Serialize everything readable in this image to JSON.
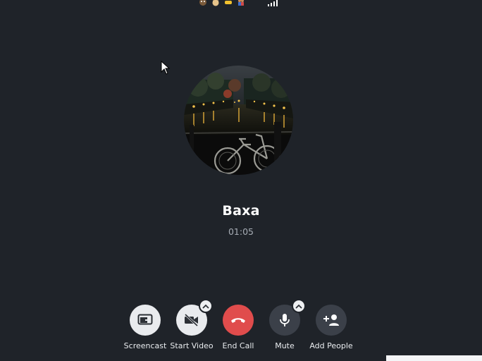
{
  "top_bar": {
    "icons": [
      "monkey-emoji-icon",
      "cat-emoji-icon",
      "pointing-hand-emoji-icon",
      "people-emoji-icon"
    ],
    "signal_icon": "signal-strength-icon"
  },
  "call": {
    "caller_name": "Baxa",
    "duration": "01:05"
  },
  "controls": {
    "screencast_label": "Screencast",
    "start_video_label": "Start Video",
    "end_call_label": "End Call",
    "mute_label": "Mute",
    "add_people_label": "Add People"
  },
  "colors": {
    "background": "#1f2329",
    "end_call": "#e04c4c",
    "light_button": "#e9ebee",
    "dark_button": "#3b4049",
    "timer_text": "#a7adb5"
  }
}
